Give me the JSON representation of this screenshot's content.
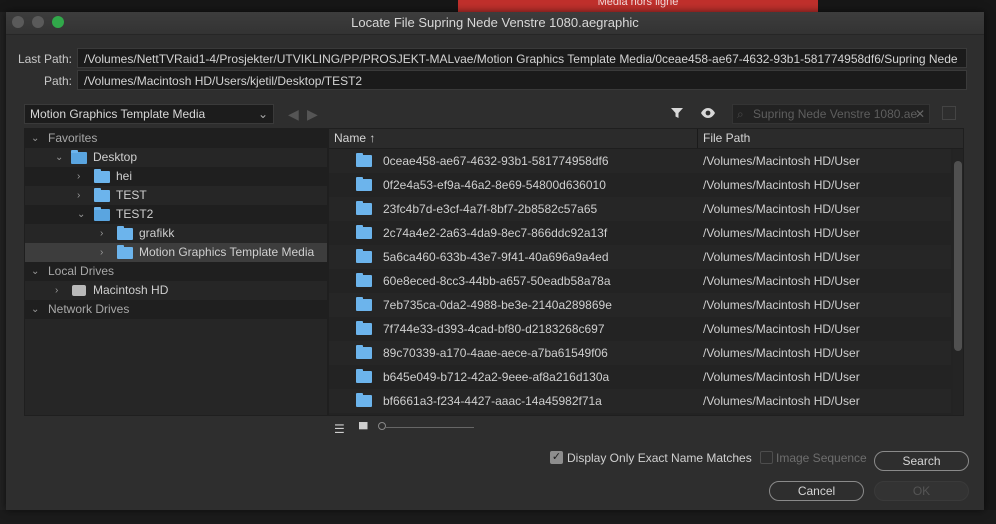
{
  "background": {
    "banner_text": "Media hors ligne"
  },
  "window": {
    "title": "Locate File Supring Nede Venstre 1080.aegraphic"
  },
  "paths": {
    "last_path_label": "Last Path:",
    "last_path_value": "/Volumes/NettTVRaid1-4/Prosjekter/UTVIKLING/PP/PROSJEKT-MALvae/Motion Graphics Template Media/0ceae458-ae67-4632-93b1-581774958df6/Supring Nede",
    "path_label": "Path:",
    "path_value": "/Volumes/Macintosh HD/Users/kjetil/Desktop/TEST2"
  },
  "location_dropdown": {
    "value": "Motion Graphics Template Media",
    "chevron": "⌄"
  },
  "nav": {
    "back_icon": "arrow-left-icon",
    "forward_icon": "arrow-right-icon"
  },
  "toolbar": {
    "filter_icon": "filter-icon",
    "eye_icon": "eye-icon",
    "search_placeholder": "Supring Nede Venstre 1080.ae"
  },
  "tree": {
    "favorites_label": "Favorites",
    "desktop_label": "Desktop",
    "hei_label": "hei",
    "test_label": "TEST",
    "test2_label": "TEST2",
    "grafikk_label": "grafikk",
    "mgt_media_label": "Motion Graphics Template Media",
    "local_drives_label": "Local Drives",
    "macintosh_hd_label": "Macintosh HD",
    "network_drives_label": "Network Drives"
  },
  "file_list": {
    "col_name": "Name",
    "sort_indicator": "↑",
    "col_path": "File Path",
    "rows": [
      {
        "name": "0ceae458-ae67-4632-93b1-581774958df6",
        "path": "/Volumes/Macintosh HD/User"
      },
      {
        "name": "0f2e4a53-ef9a-46a2-8e69-54800d636010",
        "path": "/Volumes/Macintosh HD/User"
      },
      {
        "name": "23fc4b7d-e3cf-4a7f-8bf7-2b8582c57a65",
        "path": "/Volumes/Macintosh HD/User"
      },
      {
        "name": "2c74a4e2-2a63-4da9-8ec7-866ddc92a13f",
        "path": "/Volumes/Macintosh HD/User"
      },
      {
        "name": "5a6ca460-633b-43e7-9f41-40a696a9a4ed",
        "path": "/Volumes/Macintosh HD/User"
      },
      {
        "name": "60e8eced-8cc3-44bb-a657-50eadb58a78a",
        "path": "/Volumes/Macintosh HD/User"
      },
      {
        "name": "7eb735ca-0da2-4988-be3e-2140a289869e",
        "path": "/Volumes/Macintosh HD/User"
      },
      {
        "name": "7f744e33-d393-4cad-bf80-d2183268c697",
        "path": "/Volumes/Macintosh HD/User"
      },
      {
        "name": "89c70339-a170-4aae-aece-a7ba61549f06",
        "path": "/Volumes/Macintosh HD/User"
      },
      {
        "name": "b645e049-b712-42a2-9eee-af8a216d130a",
        "path": "/Volumes/Macintosh HD/User"
      },
      {
        "name": "bf6661a3-f234-4427-aaac-14a45982f71a",
        "path": "/Volumes/Macintosh HD/User"
      }
    ]
  },
  "options": {
    "exact_match_label": "Display Only Exact Name Matches",
    "exact_match_checked": true,
    "image_sequence_label": "Image Sequence",
    "image_sequence_checked": false
  },
  "buttons": {
    "search": "Search",
    "cancel": "Cancel",
    "ok": "OK"
  },
  "colors": {
    "folder": "#6cb4ec",
    "traffic_green": "#31a84a",
    "banner": "#c0302c"
  }
}
